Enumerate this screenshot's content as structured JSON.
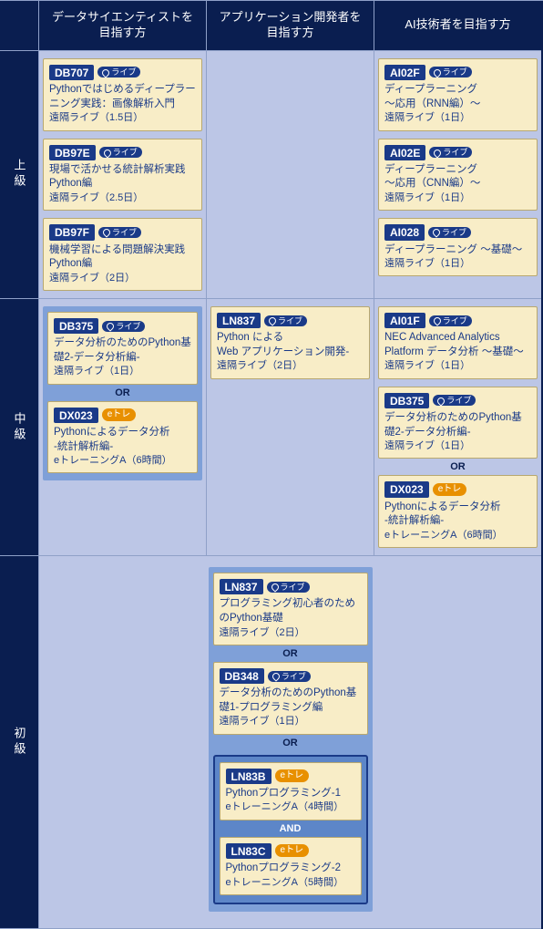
{
  "headers": {
    "col1": "データサイエンティストを\n目指す方",
    "col2": "アプリケーション開発者を\n目指す方",
    "col3": "AI技術者を目指す方"
  },
  "levels": {
    "advanced": "上級",
    "intermediate": "中級",
    "beginner": "初級"
  },
  "badges": {
    "live": "ライブ",
    "etrain": "eトレ"
  },
  "connectors": {
    "or": "OR",
    "and": "AND"
  },
  "adv": {
    "ds1": {
      "code": "DB707",
      "title": "Pythonではじめるディープラーニング実践：画像解析入門",
      "sub": "遠隔ライブ（1.5日）"
    },
    "ds2": {
      "code": "DB97E",
      "title": "現場で活かせる統計解析実践 Python編",
      "sub": "遠隔ライブ（2.5日）"
    },
    "ds3": {
      "code": "DB97F",
      "title": "機械学習による問題解決実践 Python編",
      "sub": "遠隔ライブ（2日）"
    },
    "ai1": {
      "code": "AI02F",
      "title": "ディープラーニング\n～応用（RNN編）～",
      "sub": "遠隔ライブ（1日）"
    },
    "ai2": {
      "code": "AI02E",
      "title": "ディープラーニング\n～応用（CNN編）～",
      "sub": "遠隔ライブ（1日）"
    },
    "ai3": {
      "code": "AI028",
      "title": "ディープラーニング ～基礎～",
      "sub": "遠隔ライブ（1日）"
    }
  },
  "mid": {
    "ds1": {
      "code": "DB375",
      "title": "データ分析のためのPython基礎2-データ分析編-",
      "sub": "遠隔ライブ（1日）"
    },
    "ds2": {
      "code": "DX023",
      "title": "Pythonによるデータ分析\n-統計解析編-",
      "sub": "eトレーニングA（6時間）"
    },
    "app1": {
      "code": "LN837",
      "title": "Python による\nWeb アプリケーション開発-",
      "sub": "遠隔ライブ（2日）"
    },
    "ai1": {
      "code": "AI01F",
      "title": "NEC Advanced Analytics Platform データ分析 ～基礎～",
      "sub": "遠隔ライブ（1日）"
    },
    "ai2": {
      "code": "DB375",
      "title": "データ分析のためのPython基礎2-データ分析編-",
      "sub": "遠隔ライブ（1日）"
    },
    "ai3": {
      "code": "DX023",
      "title": "Pythonによるデータ分析\n-統計解析編-",
      "sub": "eトレーニングA（6時間）"
    }
  },
  "beg": {
    "b1": {
      "code": "LN837",
      "title": "プログラミング初心者のためのPython基礎",
      "sub": "遠隔ライブ（2日）"
    },
    "b2": {
      "code": "DB348",
      "title": "データ分析のためのPython基礎1-プログラミング編",
      "sub": "遠隔ライブ（1日）"
    },
    "b3": {
      "code": "LN83B",
      "title": "Pythonプログラミング-1",
      "sub": "eトレーニングA（4時間）"
    },
    "b4": {
      "code": "LN83C",
      "title": "Pythonプログラミング-2",
      "sub": "eトレーニングA（5時間）"
    }
  }
}
